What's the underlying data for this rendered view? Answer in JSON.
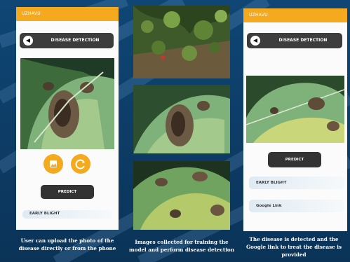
{
  "colors": {
    "accent": "#f5a91e",
    "background": "#0e3a66",
    "panel": "#fbfbfb",
    "button": "#3d3d3d"
  },
  "left_phone": {
    "header": "UZHAVU",
    "nav_label": "DISEASE DETECTION",
    "gallery_icon": "image-icon",
    "refresh_icon": "refresh-icon",
    "predict_label": "PREDICT",
    "partial_result": "EARLY BLIGHT"
  },
  "right_phone": {
    "header": "UZHAVU",
    "nav_label": "DISEASE DETECTION",
    "predict_label": "PREDICT",
    "result_label": "EARLY BLIGHT",
    "link_label": "Google Link"
  },
  "captions": {
    "left": "User can upload the photo of the disease directly or from the phone",
    "middle": "Images collected for training the model and perform disease detection",
    "right": "The disease is detected and the Google link to treat the disease is provided"
  }
}
